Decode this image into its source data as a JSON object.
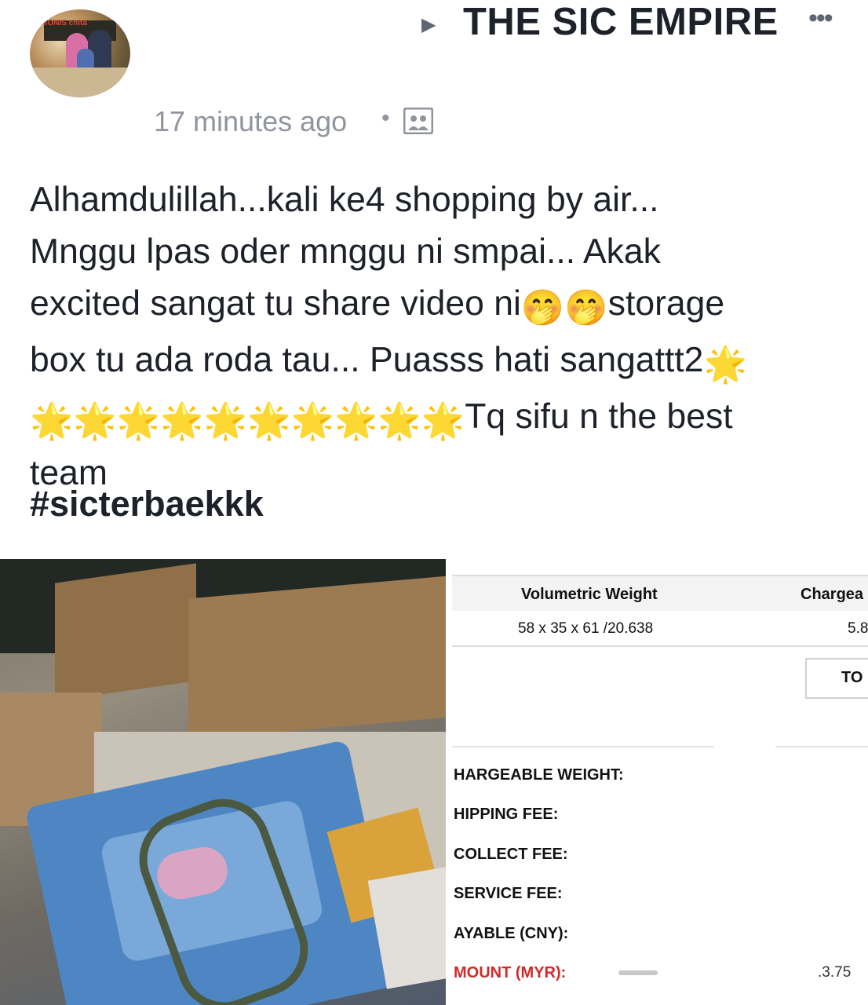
{
  "header": {
    "page_name": "THE SIC EMPIRE",
    "arrow": "▶",
    "more": "•••",
    "timestamp": "17 minutes ago",
    "separator": "•",
    "avatar_brand": "MONIS chita"
  },
  "post": {
    "line1": "Alhamdulillah...kali ke4 shopping by air...",
    "line2": "Mnggu lpas oder mnggu ni smpai... Akak",
    "line3a": "excited sangat tu share video ni",
    "emoji_face": "🤭",
    "line3b": "storage",
    "line4a": "box tu ada roda tau... Puasss hati sangattt2",
    "emoji_star": "🌟",
    "line5b": "Tq sifu n the best",
    "line6": "team",
    "hashtag": "#sicterbaekkk"
  },
  "receipt": {
    "col_volumetric": "Volumetric Weight",
    "col_chargeable": "Chargea",
    "volumetric_value": "58 x 35 x 61 /20.638",
    "chargeable_value": "5.8",
    "total_button": "TO",
    "labels": {
      "chargeable_weight": "HARGEABLE WEIGHT:",
      "shipping_fee": "HIPPING FEE:",
      "collect_fee": "COLLECT FEE:",
      "service_fee": "SERVICE FEE:",
      "payable": "AYABLE (CNY):",
      "amount": "MOUNT (MYR):"
    },
    "amount_value": ".3.75"
  },
  "colors": {
    "text": "#1d2129",
    "meta": "#90949c",
    "amount_red": "#d02a2a"
  }
}
